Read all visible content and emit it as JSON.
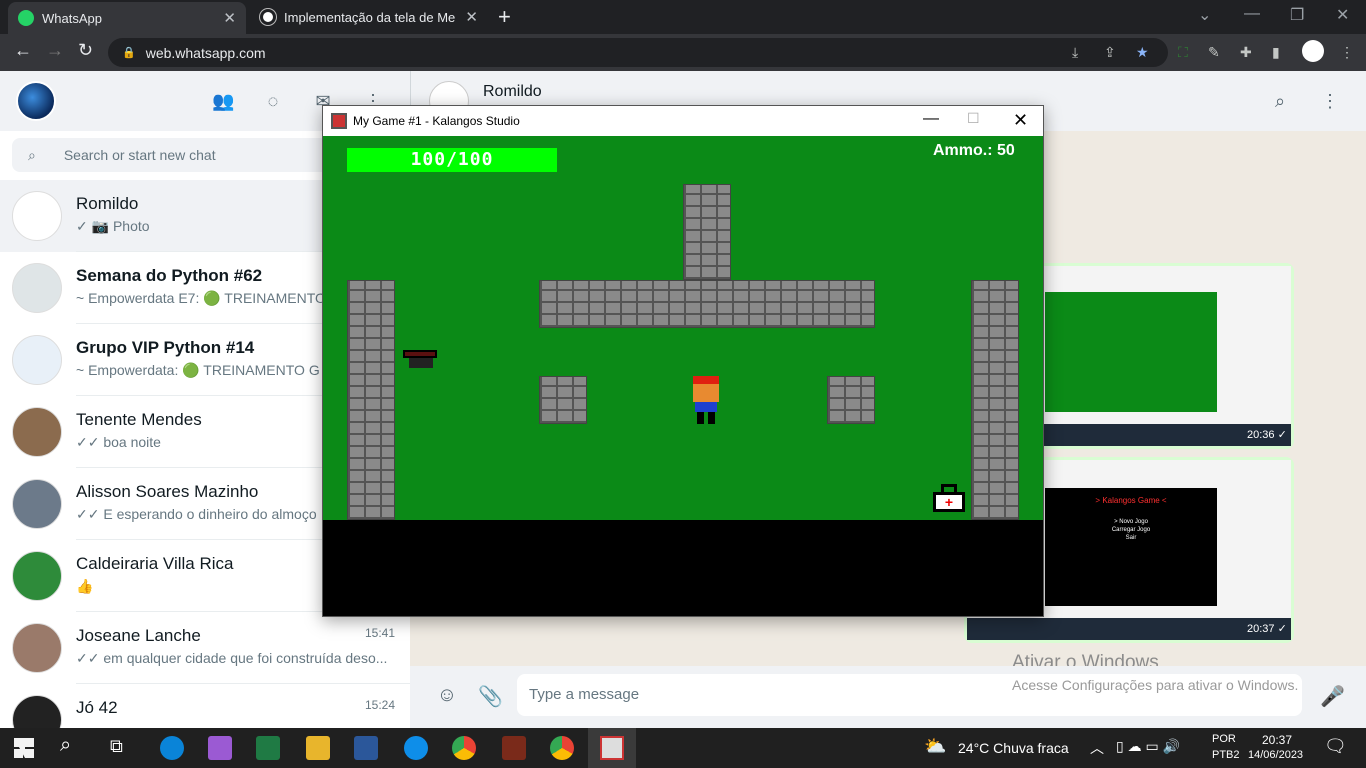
{
  "browser": {
    "tabs": [
      {
        "label": "WhatsApp",
        "active": true
      },
      {
        "label": "Implementação da tela de Menu",
        "active": false
      }
    ],
    "url": "web.whatsapp.com"
  },
  "whatsapp": {
    "search_placeholder": "Search or start new chat",
    "chats": [
      {
        "name": "Romildo",
        "preview": "✓ 📷 Photo",
        "time": "",
        "avatar_color": "#ffffff"
      },
      {
        "name": "Semana do Python #62",
        "preview": "~ Empowerdata E7: 🟢 TREINAMENTO",
        "time": "",
        "avatar_color": "#dfe5e7"
      },
      {
        "name": "Grupo VIP Python #14",
        "preview": "~ Empowerdata: 🟢 TREINAMENTO G",
        "time": "",
        "avatar_color": "#e8f0f8"
      },
      {
        "name": "Tenente Mendes",
        "preview": "✓✓ boa noite",
        "time": "",
        "avatar_color": "#8b6b4e"
      },
      {
        "name": "Alisson Soares Mazinho",
        "preview": "✓✓ E esperando o dinheiro do almoço",
        "time": "",
        "avatar_color": "#6c7a8a"
      },
      {
        "name": "Caldeiraria Villa Rica",
        "preview": "👍",
        "time": "",
        "avatar_color": "#2e8b3a"
      },
      {
        "name": "Joseane Lanche",
        "preview": "✓✓ em qualquer cidade que foi construída deso...",
        "time": "15:41",
        "avatar_color": "#9a7a6a"
      },
      {
        "name": "Jó 42",
        "preview": "",
        "time": "15:24",
        "avatar_color": "#222222"
      }
    ],
    "active_chat": {
      "name": "Romildo"
    },
    "message_placeholder": "Type a message",
    "thumb_times": [
      "20:36 ✓",
      "20:37 ✓"
    ],
    "thumb_menu": {
      "title": "> Kalangos Game <",
      "items": [
        "> Novo Jogo",
        "Carregar Jogo",
        "Sair"
      ]
    }
  },
  "windows_watermark": {
    "line1": "Ativar o Windows",
    "line2": "Acesse Configurações para ativar o Windows."
  },
  "game_window": {
    "title": "My Game #1 - Kalangos Studio",
    "health": "100/100",
    "health_fraction": 1.0,
    "ammo": "Ammo.: 50"
  },
  "taskbar": {
    "weather": "24°C  Chuva fraca",
    "lang": "POR",
    "layout": "PTB2",
    "time": "20:37",
    "date": "14/06/2023"
  }
}
